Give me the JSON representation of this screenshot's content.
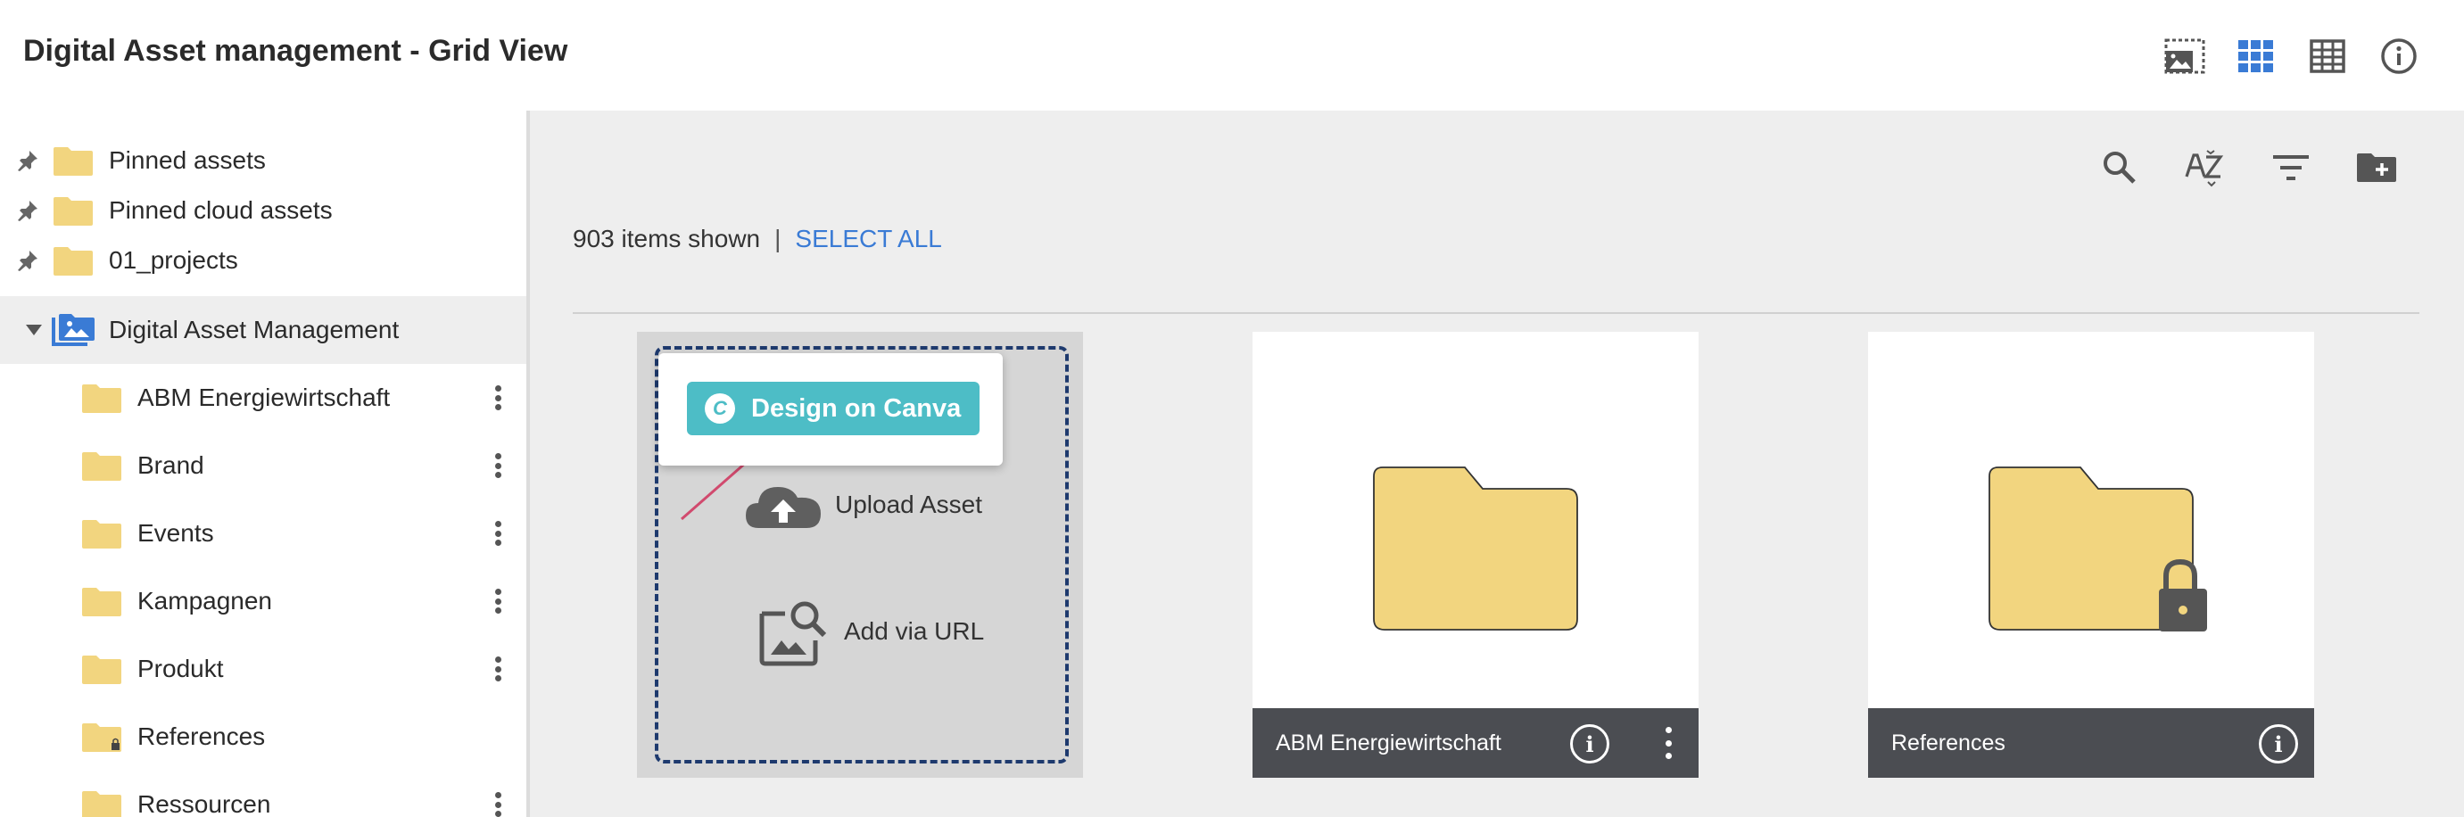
{
  "header": {
    "title": "Digital Asset management - Grid View",
    "icons": [
      "thumbnail-view-icon",
      "grid-view-icon",
      "table-view-icon",
      "info-icon"
    ],
    "accent": "#3a7bd5"
  },
  "sidebar": {
    "pinned": [
      {
        "label": "Pinned assets"
      },
      {
        "label": "Pinned cloud assets"
      },
      {
        "label": "01_projects"
      }
    ],
    "root": {
      "label": "Digital Asset Management"
    },
    "folders": [
      {
        "label": "ABM Energiewirtschaft",
        "locked": false
      },
      {
        "label": "Brand",
        "locked": false
      },
      {
        "label": "Events",
        "locked": false
      },
      {
        "label": "Kampagnen",
        "locked": false
      },
      {
        "label": "Produkt",
        "locked": false
      },
      {
        "label": "References",
        "locked": true
      },
      {
        "label": "Ressourcen",
        "locked": false
      }
    ]
  },
  "toolbar": {
    "icons": [
      "search-icon",
      "sort-az-icon",
      "filter-icon",
      "new-folder-icon"
    ]
  },
  "summary": {
    "count_text": "903 items shown",
    "separator": "|",
    "select_all": "SELECT ALL"
  },
  "upload_card": {
    "canva_label": "Design on Canva",
    "canva_logo": "C",
    "canva_color": "#4dbdc6",
    "upload_label": "Upload Asset",
    "url_label": "Add via URL"
  },
  "cards": [
    {
      "name": "ABM Energiewirtschaft",
      "locked": false
    },
    {
      "name": "References",
      "locked": true
    }
  ],
  "folder_color": "#f2d57f"
}
